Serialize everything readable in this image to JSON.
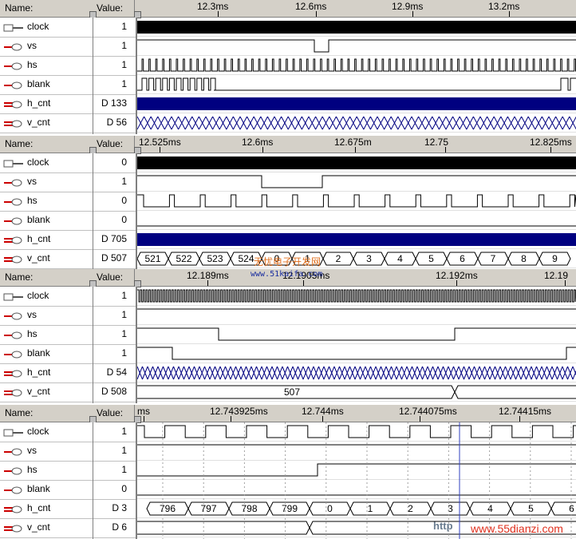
{
  "header": {
    "name_label": "Name:",
    "value_label": "Value:"
  },
  "signals": [
    "clock",
    "vs",
    "hs",
    "blank",
    "h_cnt",
    "v_cnt"
  ],
  "panels": [
    {
      "ticks": [
        "12.3ms",
        "12.6ms",
        "12.9ms",
        "13.2ms"
      ],
      "values": [
        "1",
        "1",
        "1",
        "1",
        "D 133",
        "D 56"
      ],
      "bus_labels": []
    },
    {
      "ticks": [
        "12.525ms",
        "12.6ms",
        "12.675m",
        "12.75",
        "12.825ms"
      ],
      "values": [
        "0",
        "1",
        "0",
        "0",
        "D 705",
        "D 507"
      ],
      "bus_labels": [
        "521",
        "522",
        "523",
        "524",
        "0",
        "1",
        "2",
        "3",
        "4",
        "5",
        "6",
        "7",
        "8",
        "9"
      ]
    },
    {
      "ticks": [
        "12.189ms",
        "12.1905ms",
        "12.192ms",
        "12.19"
      ],
      "values": [
        "1",
        "1",
        "1",
        "1",
        "D 54",
        "D 508"
      ],
      "bus_labels": [
        "507"
      ]
    },
    {
      "ticks": [
        "ms",
        "12.743925ms",
        "12.744ms",
        "12.744075ms",
        "12.74415ms"
      ],
      "values": [
        "1",
        "1",
        "1",
        "0",
        "D 3",
        "D 6"
      ],
      "bus_labels": [
        "796",
        "797",
        "798",
        "799",
        "0",
        "1",
        "2",
        "3",
        "4",
        "5",
        "6"
      ]
    }
  ],
  "watermarks": {
    "cn": "无忧电子开发网",
    "url": "www.51kaifa.com",
    "http": "http",
    "site": "www.55dianzi.com"
  },
  "colors": {
    "bus_fill": "#000080",
    "background": "#ffffff",
    "header": "#d4d0c8",
    "signal_icon": "#cc0000",
    "cursor": "#3040c0"
  },
  "icons": {
    "input": "input-pin-icon",
    "output": "output-pin-icon",
    "bus": "bus-output-icon"
  }
}
